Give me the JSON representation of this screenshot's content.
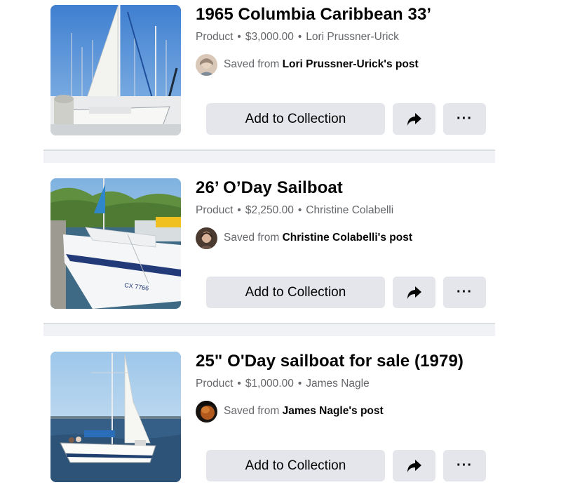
{
  "items": [
    {
      "title": "1965 Columbia Caribbean 33’",
      "type": "Product",
      "price": "$3,000.00",
      "seller": "Lori Prussner-Urick",
      "saved_prefix": "Saved from",
      "saved_source": "Lori Prussner-Urick's post",
      "add_label": "Add to Collection",
      "more_label": "···",
      "image": "sailboat-docked-marina-photo",
      "avatar": "lori-avatar"
    },
    {
      "title": "26’ O’Day Sailboat",
      "type": "Product",
      "price": "$2,250.00",
      "seller": "Christine Colabelli",
      "saved_prefix": "Saved from",
      "saved_source": "Christine Colabelli's post",
      "add_label": "Add to Collection",
      "more_label": "···",
      "image": "sailboat-at-dock-photo",
      "avatar": "christine-avatar"
    },
    {
      "title": "25\" O'Day sailboat for sale (1979)",
      "type": "Product",
      "price": "$1,000.00",
      "seller": "James Nagle",
      "saved_prefix": "Saved from",
      "saved_source": "James Nagle's post",
      "add_label": "Add to Collection",
      "more_label": "···",
      "image": "sailboat-on-water-photo",
      "avatar": "james-avatar"
    }
  ],
  "icons": {
    "share": "share-arrow-icon",
    "more": "more-options-icon"
  },
  "colors": {
    "button_bg": "#e4e6eb",
    "text_primary": "#050505",
    "text_secondary": "#65676b",
    "divider_bg": "#f0f2f5"
  }
}
